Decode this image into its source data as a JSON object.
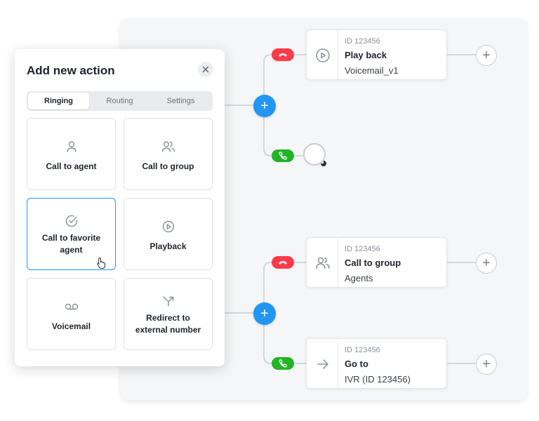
{
  "panel": {
    "title": "Add new action",
    "tabs": [
      {
        "label": "Ringing",
        "active": true
      },
      {
        "label": "Routing",
        "active": false
      },
      {
        "label": "Settings",
        "active": false
      }
    ],
    "actions": [
      {
        "label": "Call to agent",
        "icon": "person-icon"
      },
      {
        "label": "Call to group",
        "icon": "group-icon"
      },
      {
        "label": "Call to favorite agent",
        "icon": "check-circle-icon",
        "selected": true
      },
      {
        "label": "Playback",
        "icon": "play-circle-icon"
      },
      {
        "label": "Voicemail",
        "icon": "voicemail-icon"
      },
      {
        "label": "Redirect to external number",
        "icon": "redirect-arrow-icon"
      }
    ]
  },
  "flow": {
    "nodes": [
      {
        "id_label": "ID 123456",
        "title": "Play back",
        "subtitle": "Voicemail_v1",
        "icon": "play-circle-icon"
      },
      {
        "id_label": "ID 123456",
        "title": "Call to group",
        "subtitle": "Agents",
        "icon": "group-icon"
      },
      {
        "id_label": "ID 123456",
        "title": "Go to",
        "subtitle": "IVR (ID 123456)",
        "icon": "arrow-right-icon"
      }
    ],
    "branch_colors": {
      "declined": "#ff3b4a",
      "answered": "#23b326",
      "add": "#2196f3"
    }
  }
}
